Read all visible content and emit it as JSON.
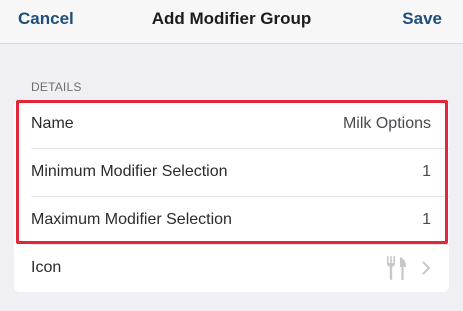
{
  "navbar": {
    "cancel_label": "Cancel",
    "title": "Add Modifier Group",
    "save_label": "Save"
  },
  "details": {
    "header": "DETAILS",
    "rows": [
      {
        "label": "Name",
        "value": "Milk Options"
      },
      {
        "label": "Minimum Modifier Selection",
        "value": "1"
      },
      {
        "label": "Maximum Modifier Selection",
        "value": "1"
      },
      {
        "label": "Icon",
        "icon": "fork-knife-icon"
      }
    ]
  },
  "colors": {
    "accent": "#1f4e7a",
    "highlight": "#e3263a",
    "background": "#efeff4"
  }
}
